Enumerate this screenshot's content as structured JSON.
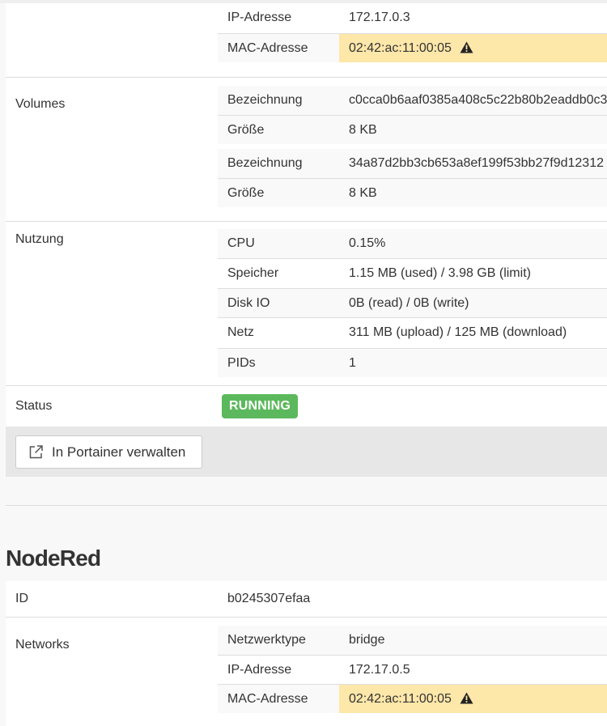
{
  "container1": {
    "network_rows": [
      {
        "key": "IP-Adresse",
        "value": "172.17.0.3",
        "warn": false
      },
      {
        "key": "MAC-Adresse",
        "value": "02:42:ac:11:00:05",
        "warn": true
      }
    ],
    "volumes": {
      "label": "Volumes",
      "items": [
        {
          "name_key": "Bezeichnung",
          "name_value": "c0cca0b6aaf0385a408c5c22b80b2eaddb0c3",
          "size_key": "Größe",
          "size_value": "8 KB"
        },
        {
          "name_key": "Bezeichnung",
          "name_value": "34a87d2bb3cb653a8ef199f53bb27f9d12312",
          "size_key": "Größe",
          "size_value": "8 KB"
        }
      ]
    },
    "usage": {
      "label": "Nutzung",
      "rows": [
        {
          "key": "CPU",
          "value": "0.15%"
        },
        {
          "key": "Speicher",
          "value": "1.15 MB (used) / 3.98 GB (limit)"
        },
        {
          "key": "Disk IO",
          "value": "0B (read) / 0B (write)"
        },
        {
          "key": "Netz",
          "value": "311 MB (upload) / 125 MB (download)"
        },
        {
          "key": "PIDs",
          "value": "1"
        }
      ]
    },
    "status": {
      "label": "Status",
      "value": "RUNNING",
      "color": "#5cb85c"
    },
    "portainer_button": {
      "label": "In Portainer verwalten",
      "icon": "external-link-icon"
    }
  },
  "container2": {
    "title": "NodeRed",
    "id_label": "ID",
    "id_value": "b0245307efaa",
    "networks_label": "Networks",
    "network_rows": [
      {
        "key": "Netzwerktype",
        "value": "bridge",
        "warn": false
      },
      {
        "key": "IP-Adresse",
        "value": "172.17.0.5",
        "warn": false
      },
      {
        "key": "MAC-Adresse",
        "value": "02:42:ac:11:00:05",
        "warn": true
      }
    ]
  },
  "colors": {
    "warning_bg": "#fde7a9",
    "success": "#5cb85c"
  }
}
